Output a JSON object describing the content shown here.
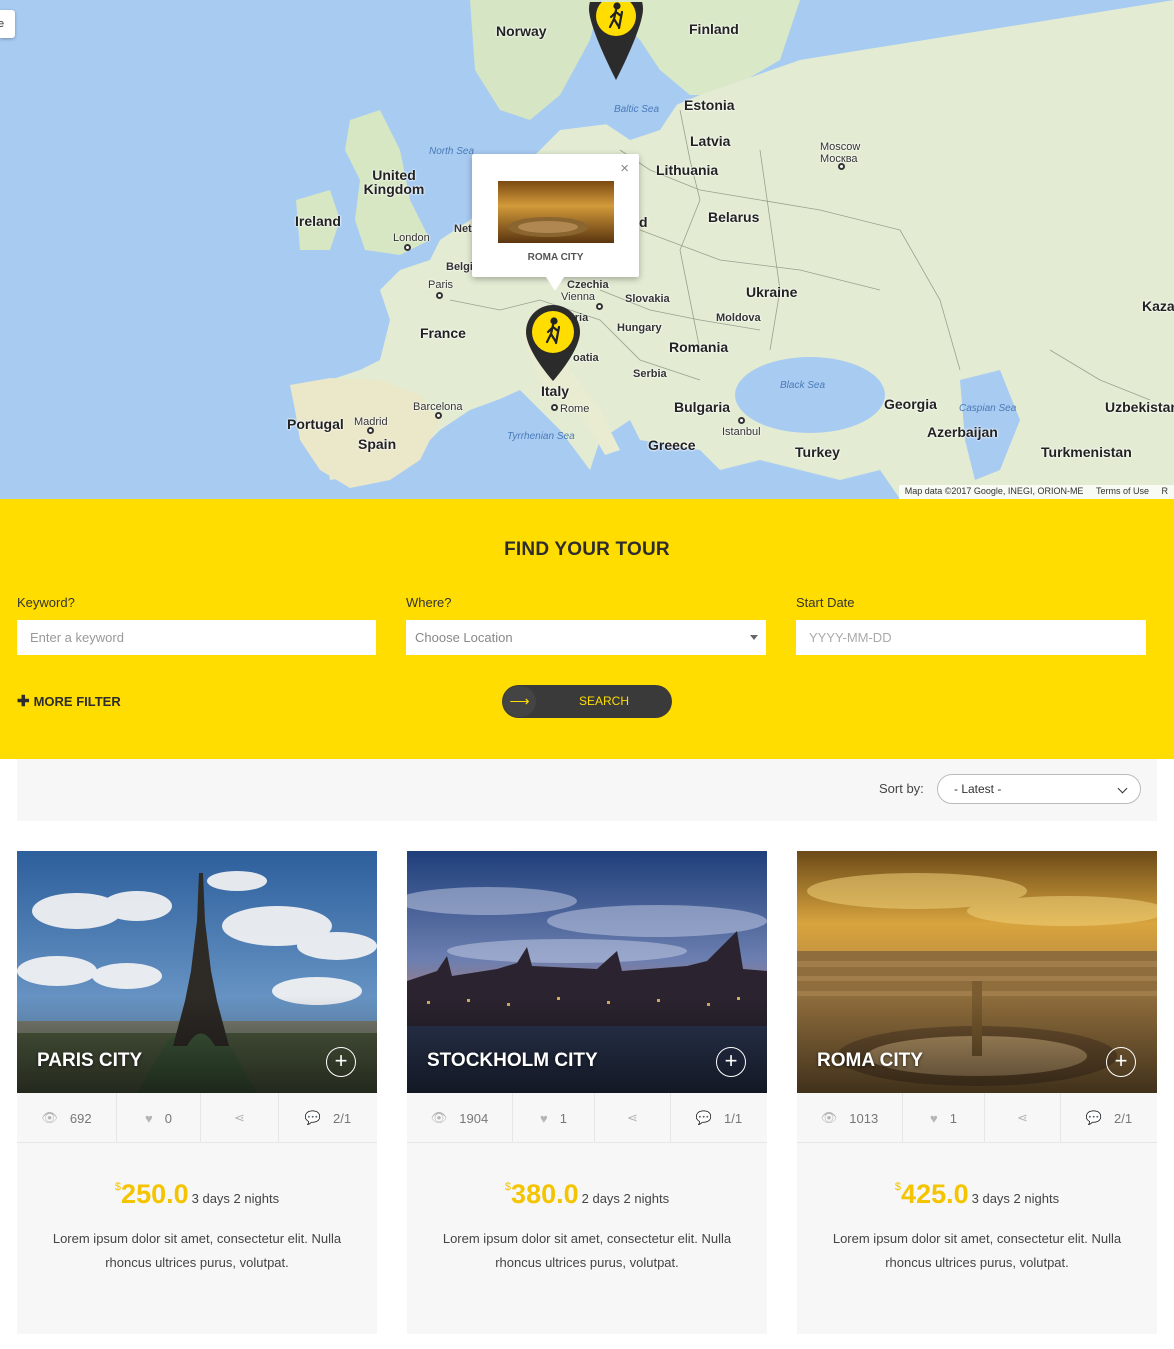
{
  "map": {
    "corner_tab_text": "e",
    "attribution": "Map data ©2017 Google, INEGI, ORION-ME",
    "terms": "Terms of Use",
    "attr_extra": "R",
    "countries": [
      {
        "name": "Norway"
      },
      {
        "name": "Finland"
      },
      {
        "name": "Estonia"
      },
      {
        "name": "Latvia"
      },
      {
        "name": "Lithuania"
      },
      {
        "name": "Belarus"
      },
      {
        "name": "United Kingdom"
      },
      {
        "name": "Ireland"
      },
      {
        "name": "France"
      },
      {
        "name": "Ukraine"
      },
      {
        "name": "Romania"
      },
      {
        "name": "Portugal"
      },
      {
        "name": "Spain"
      },
      {
        "name": "Bulgaria"
      },
      {
        "name": "Greece"
      },
      {
        "name": "Turkey"
      },
      {
        "name": "Georgia"
      },
      {
        "name": "Azerbaijan"
      },
      {
        "name": "Uzbekistan"
      },
      {
        "name": "Turkmenistan"
      },
      {
        "name": "Kaza"
      },
      {
        "name": "Italy"
      }
    ],
    "cities": [
      {
        "name": "London"
      },
      {
        "name": "Paris"
      },
      {
        "name": "Moscow"
      },
      {
        "name": "Москва"
      },
      {
        "name": "Madrid"
      },
      {
        "name": "Barcelona"
      },
      {
        "name": "Rome"
      },
      {
        "name": "Istanbul"
      },
      {
        "name": "Vienna"
      },
      {
        "name": "Czechia"
      },
      {
        "name": "Slovakia"
      },
      {
        "name": "Hungary"
      },
      {
        "name": "Moldova"
      },
      {
        "name": "Serbia"
      },
      {
        "name": "Belgi"
      },
      {
        "name": "Neth"
      },
      {
        "name": "oatia"
      },
      {
        "name": "stria"
      },
      {
        "name": "d"
      }
    ],
    "seas": [
      "Baltic Sea",
      "North Sea",
      "Black Sea",
      "Caspian Sea",
      "Tyrrhenian Sea"
    ],
    "popup": {
      "title": "ROMA CITY",
      "close": "×"
    }
  },
  "search": {
    "title": "FIND YOUR TOUR",
    "keyword_label": "Keyword?",
    "keyword_placeholder": "Enter a keyword",
    "where_label": "Where?",
    "where_value": "Choose Location",
    "date_label": "Start Date",
    "date_placeholder": "YYYY-MM-DD",
    "more_filter": "MORE FILTER",
    "more_filter_icon": "plus-icon",
    "search_button": "SEARCH",
    "search_button_icon": "arrow-right-icon"
  },
  "sort": {
    "label": "Sort by:",
    "value": "- Latest -"
  },
  "colors": {
    "accent": "#ffdd00",
    "price": "#f5c400",
    "dark_button": "#3a3a3a"
  },
  "tours": [
    {
      "title": "PARIS CITY",
      "views": "692",
      "likes": "0",
      "comments": "2/1",
      "currency": "$",
      "price": "250.0",
      "duration": "3 days 2 nights",
      "description": "Lorem ipsum dolor sit amet, consectetur elit. Nulla rhoncus ultrices purus, volutpat."
    },
    {
      "title": "STOCKHOLM CITY",
      "views": "1904",
      "likes": "1",
      "comments": "1/1",
      "currency": "$",
      "price": "380.0",
      "duration": "2 days 2 nights",
      "description": "Lorem ipsum dolor sit amet, consectetur elit. Nulla rhoncus ultrices purus, volutpat."
    },
    {
      "title": "ROMA CITY",
      "views": "1013",
      "likes": "1",
      "comments": "2/1",
      "currency": "$",
      "price": "425.0",
      "duration": "3 days 2 nights",
      "description": "Lorem ipsum dolor sit amet, consectetur elit. Nulla rhoncus ultrices purus, volutpat."
    }
  ]
}
